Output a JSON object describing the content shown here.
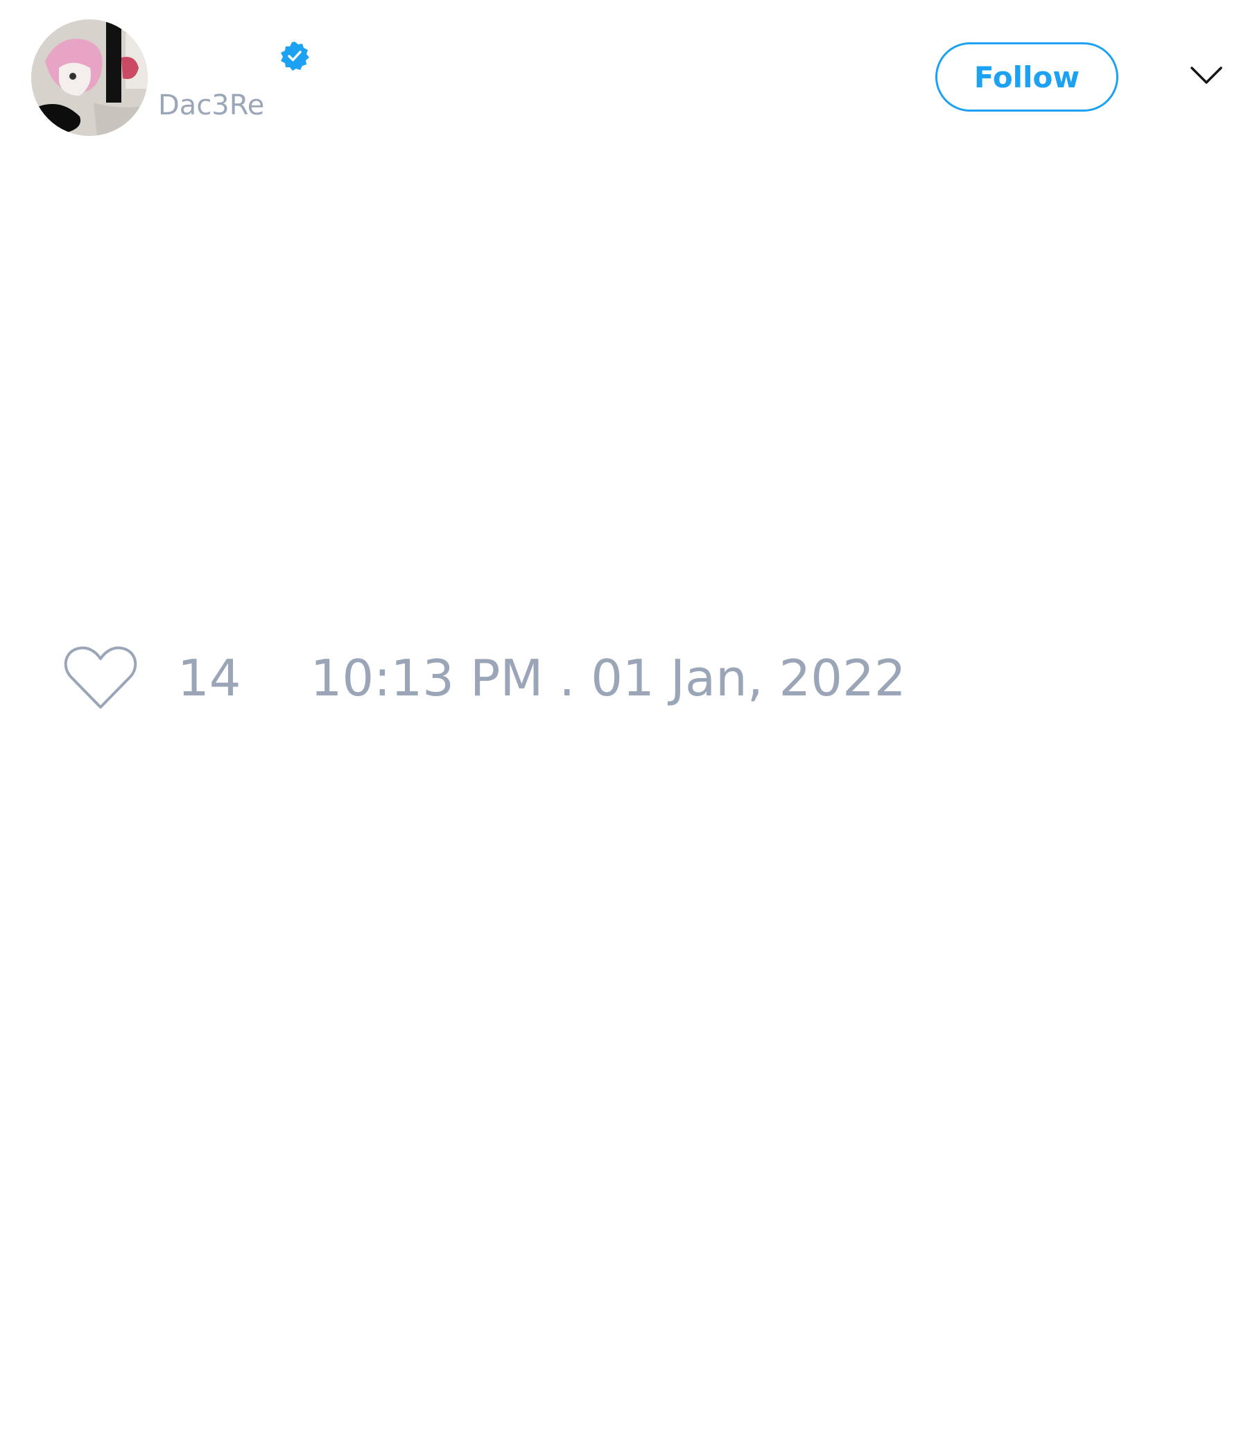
{
  "tweet": {
    "author": {
      "display_name": "",
      "handle": "Dac3Re",
      "verified": true
    },
    "follow_label": "Follow",
    "like_count": "14",
    "timestamp": "10:13 PM . 01 Jan, 2022"
  },
  "icons": {
    "avatar": "avatar-image",
    "verified": "verified-badge-icon",
    "menu": "chevron-down-icon",
    "like": "heart-icon"
  },
  "colors": {
    "accent": "#1da1f2",
    "muted_text": "#9aa6b8",
    "background": "#ffffff"
  }
}
